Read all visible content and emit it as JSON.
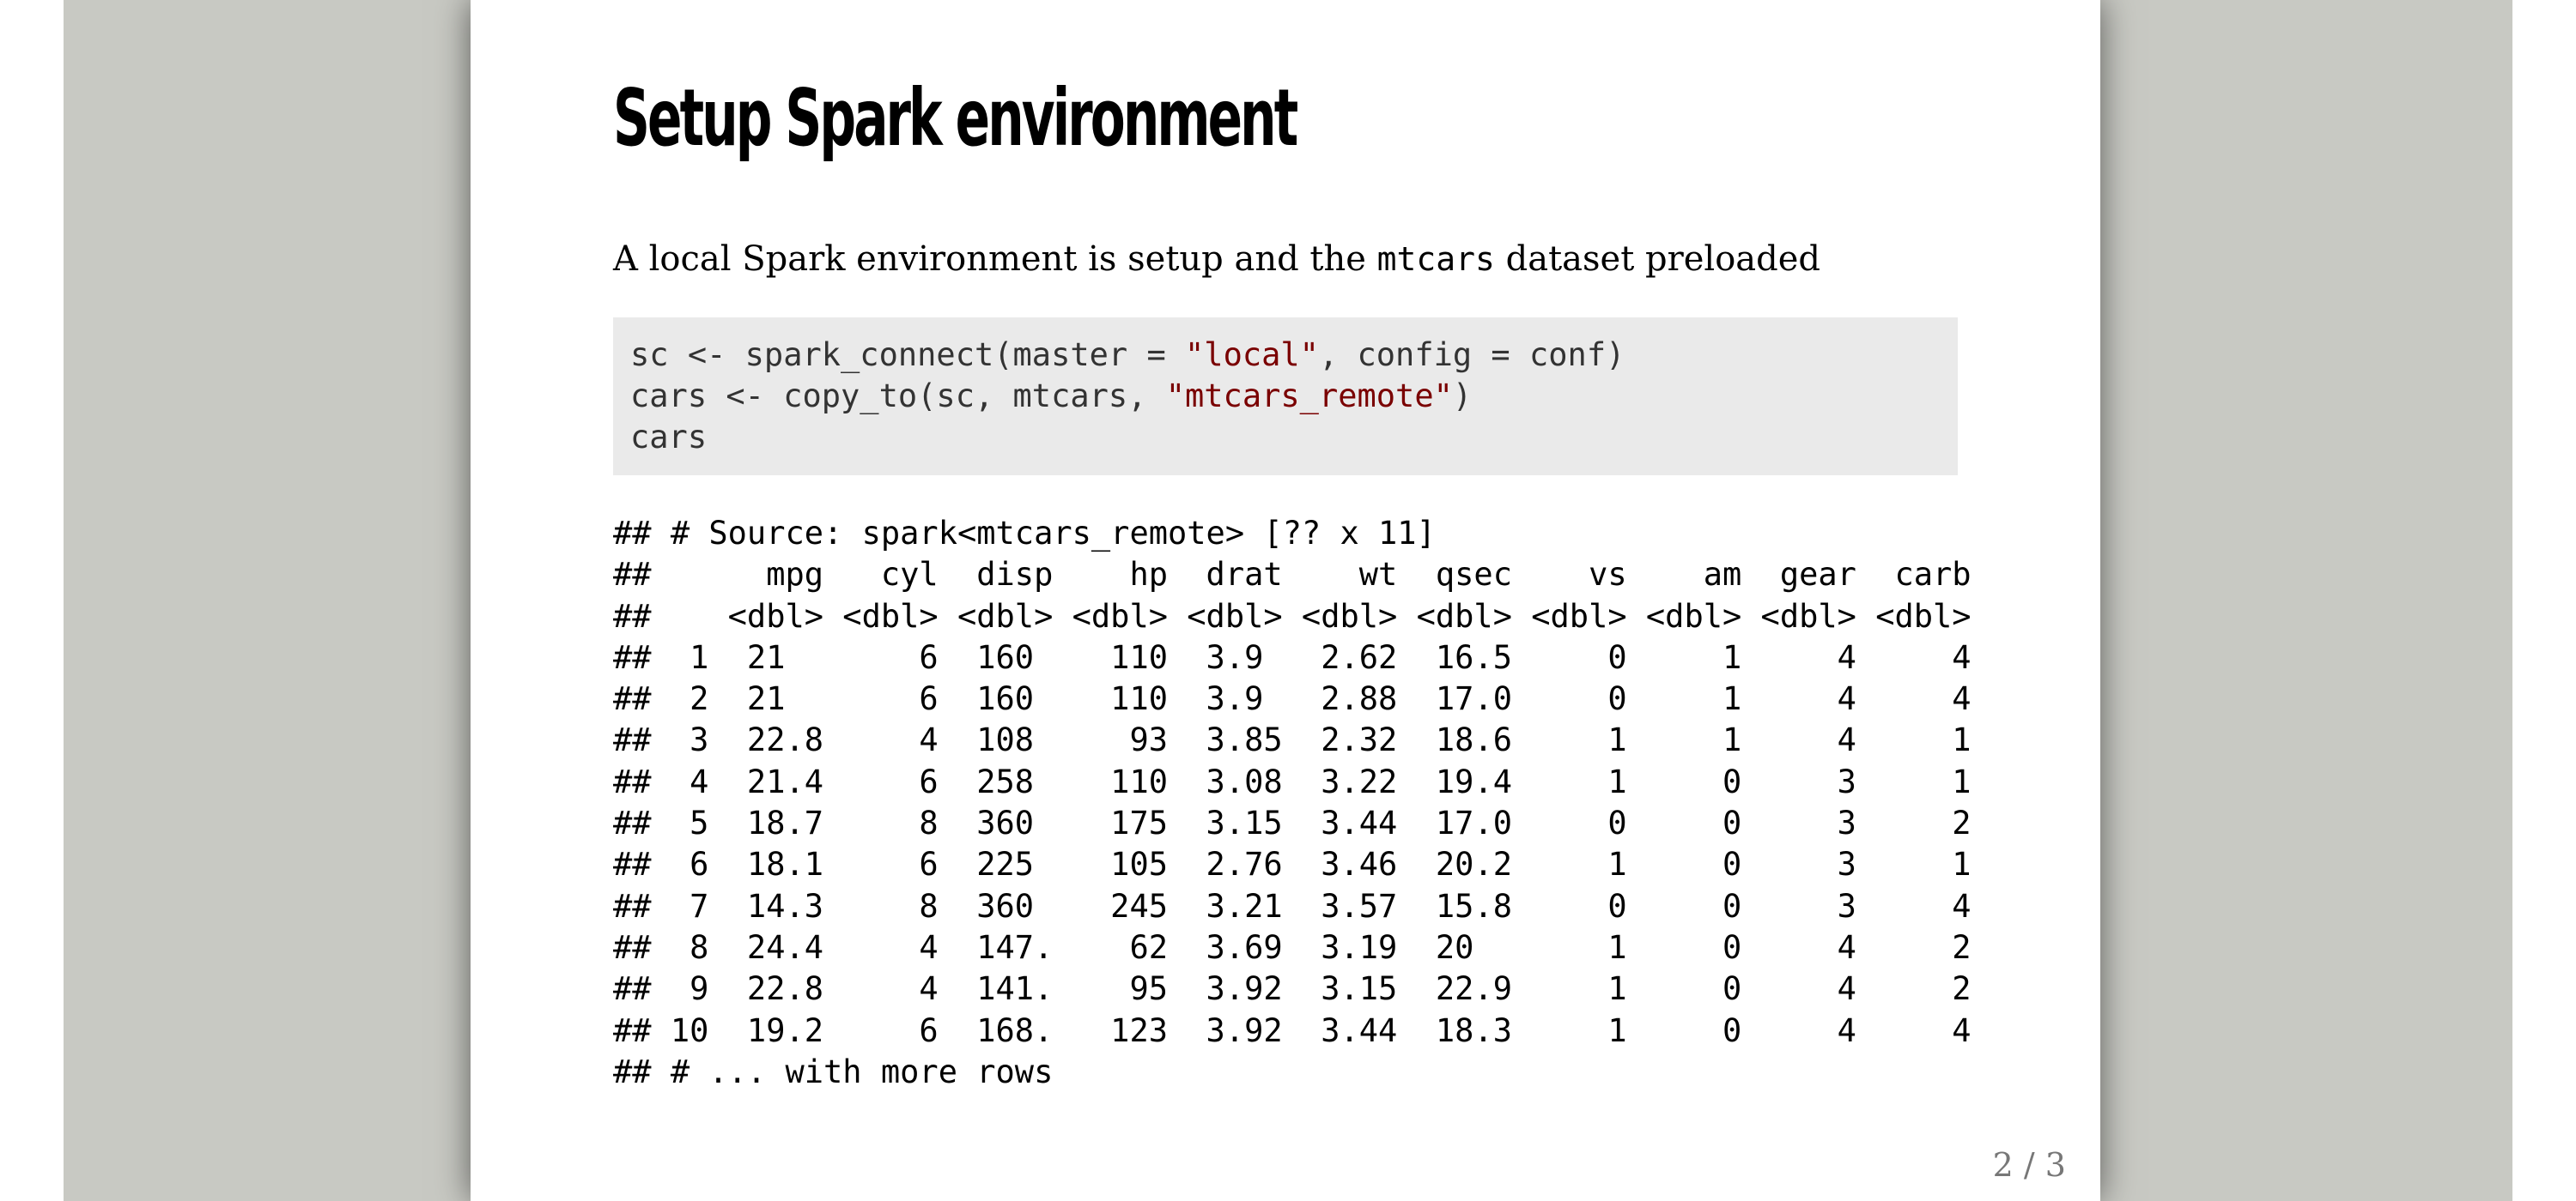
{
  "slide": {
    "title": "Setup Spark environment",
    "intro": {
      "before": "A local Spark environment is setup and the ",
      "code": "mtcars",
      "after": " dataset preloaded"
    },
    "code_lines": [
      {
        "pre": "sc <- spark_connect(master = ",
        "str": "\"local\"",
        "post": ", config = conf)"
      },
      {
        "pre": "cars <- copy_to(sc, mtcars, ",
        "str": "\"mtcars_remote\"",
        "post": ")"
      },
      {
        "pre": "cars",
        "str": "",
        "post": ""
      }
    ],
    "output_lines": [
      "## # Source: spark<mtcars_remote> [?? x 11]",
      "##      mpg   cyl  disp    hp  drat    wt  qsec    vs    am  gear  carb",
      "##    <dbl> <dbl> <dbl> <dbl> <dbl> <dbl> <dbl> <dbl> <dbl> <dbl> <dbl>",
      "##  1  21       6  160    110  3.9   2.62  16.5     0     1     4     4",
      "##  2  21       6  160    110  3.9   2.88  17.0     0     1     4     4",
      "##  3  22.8     4  108     93  3.85  2.32  18.6     1     1     4     1",
      "##  4  21.4     6  258    110  3.08  3.22  19.4     1     0     3     1",
      "##  5  18.7     8  360    175  3.15  3.44  17.0     0     0     3     2",
      "##  6  18.1     6  225    105  2.76  3.46  20.2     1     0     3     1",
      "##  7  14.3     8  360    245  3.21  3.57  15.8     0     0     3     4",
      "##  8  24.4     4  147.    62  3.69  3.19  20       1     0     4     2",
      "##  9  22.8     4  141.    95  3.92  3.15  22.9     1     0     4     2",
      "## 10  19.2     6  168.   123  3.92  3.44  18.3     1     0     4     4",
      "## # ... with more rows"
    ],
    "page_number": "2 / 3"
  }
}
